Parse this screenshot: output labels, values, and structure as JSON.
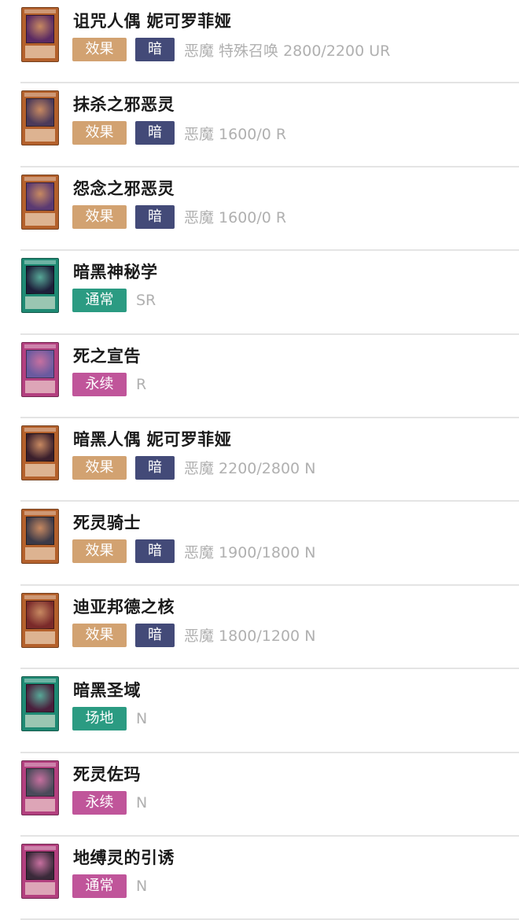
{
  "colors": {
    "effect": "#d2a271",
    "attr_dark": "#434a78",
    "normal_spell": "#2b9b82",
    "field_spell": "#2b9b82",
    "continuous_trap": "#c0559a",
    "normal_trap": "#c0559a",
    "stats_text": "#b0b0b0",
    "divider": "#e4e4e4"
  },
  "cards": [
    {
      "name": "诅咒人偶 妮可罗菲娅",
      "type_label": "效果",
      "type_color": "#d2a271",
      "attribute": "暗",
      "attribute_color": "#434a78",
      "stats": "恶魔 特殊召唤 2800/2200 UR",
      "thumb_icon": "monster-card-thumbnail",
      "thumb_frame": "#b4612c",
      "thumb_art": "#5a2a63"
    },
    {
      "name": "抹杀之邪恶灵",
      "type_label": "效果",
      "type_color": "#d2a271",
      "attribute": "暗",
      "attribute_color": "#434a78",
      "stats": "恶魔 1600/0 R",
      "thumb_icon": "monster-card-thumbnail",
      "thumb_frame": "#b4612c",
      "thumb_art": "#4b3a5a"
    },
    {
      "name": "怨念之邪恶灵",
      "type_label": "效果",
      "type_color": "#d2a271",
      "attribute": "暗",
      "attribute_color": "#434a78",
      "stats": "恶魔 1600/0 R",
      "thumb_icon": "monster-card-thumbnail",
      "thumb_frame": "#b4612c",
      "thumb_art": "#5b3a72"
    },
    {
      "name": "暗黑神秘学",
      "type_label": "通常",
      "type_color": "#2b9b82",
      "attribute": "",
      "attribute_color": "",
      "stats": "SR",
      "thumb_icon": "spell-card-thumbnail",
      "thumb_frame": "#1f8a74",
      "thumb_art": "#1d1f3a"
    },
    {
      "name": "死之宣告",
      "type_label": "永续",
      "type_color": "#c0559a",
      "attribute": "",
      "attribute_color": "",
      "stats": "R",
      "thumb_icon": "trap-card-thumbnail",
      "thumb_frame": "#b3407f",
      "thumb_art": "#6a5aa0"
    },
    {
      "name": "暗黑人偶 妮可罗菲娅",
      "type_label": "效果",
      "type_color": "#d2a271",
      "attribute": "暗",
      "attribute_color": "#434a78",
      "stats": "恶魔 2200/2800 N",
      "thumb_icon": "monster-card-thumbnail",
      "thumb_frame": "#b4612c",
      "thumb_art": "#3a1f2c"
    },
    {
      "name": "死灵骑士",
      "type_label": "效果",
      "type_color": "#d2a271",
      "attribute": "暗",
      "attribute_color": "#434a78",
      "stats": "恶魔 1900/1800 N",
      "thumb_icon": "monster-card-thumbnail",
      "thumb_frame": "#b4612c",
      "thumb_art": "#3c3a48"
    },
    {
      "name": "迪亚邦德之核",
      "type_label": "效果",
      "type_color": "#d2a271",
      "attribute": "暗",
      "attribute_color": "#434a78",
      "stats": "恶魔 1800/1200 N",
      "thumb_icon": "monster-card-thumbnail",
      "thumb_frame": "#b4612c",
      "thumb_art": "#7a2a2a"
    },
    {
      "name": "暗黑圣域",
      "type_label": "场地",
      "type_color": "#2b9b82",
      "attribute": "",
      "attribute_color": "",
      "stats": "N",
      "thumb_icon": "spell-card-thumbnail",
      "thumb_frame": "#1f8a74",
      "thumb_art": "#4a1f3c"
    },
    {
      "name": "死灵佐玛",
      "type_label": "永续",
      "type_color": "#c0559a",
      "attribute": "",
      "attribute_color": "",
      "stats": "N",
      "thumb_icon": "trap-card-thumbnail",
      "thumb_frame": "#b3407f",
      "thumb_art": "#4a4a5a"
    },
    {
      "name": "地缚灵的引诱",
      "type_label": "通常",
      "type_color": "#c0559a",
      "attribute": "",
      "attribute_color": "",
      "stats": "N",
      "thumb_icon": "trap-card-thumbnail",
      "thumb_frame": "#b3407f",
      "thumb_art": "#3a2a3a"
    }
  ]
}
